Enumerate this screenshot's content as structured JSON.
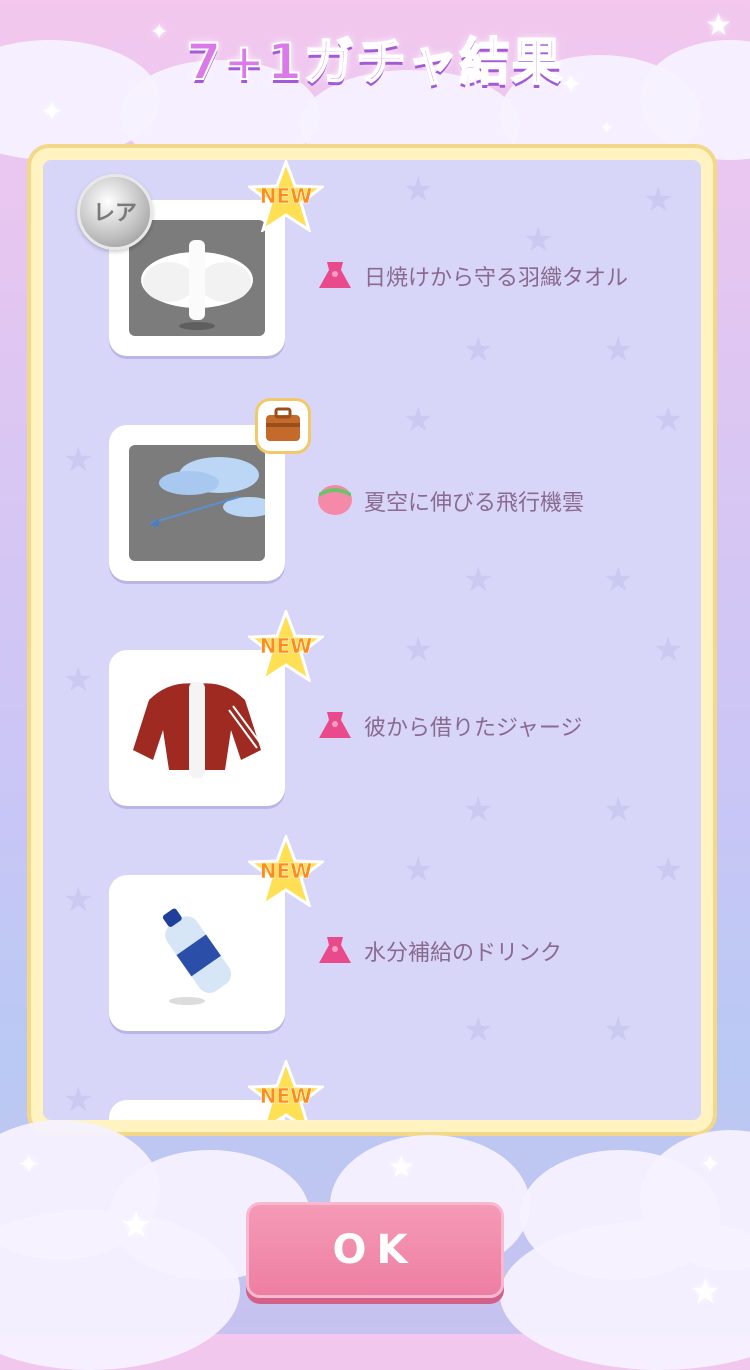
{
  "header": {
    "title": "7+1ガチャ結果"
  },
  "items": [
    {
      "name": "日焼けから守る羽織タオル",
      "badge": "NEW",
      "rare_label": "レア",
      "category_icon": "dress-icon",
      "thumb_bg": "gray",
      "thumb_icon": "towel-icon"
    },
    {
      "name": "夏空に伸びる飛行機雲",
      "badge": "",
      "category_icon": "background-icon",
      "thumb_bg": "gray",
      "thumb_icon": "contrail-icon",
      "extra_icon": "bag-icon"
    },
    {
      "name": "彼から借りたジャージ",
      "badge": "NEW",
      "category_icon": "dress-icon",
      "thumb_bg": "white",
      "thumb_icon": "jersey-icon"
    },
    {
      "name": "水分補給のドリンク",
      "badge": "NEW",
      "category_icon": "dress-icon",
      "thumb_bg": "white",
      "thumb_icon": "bottle-icon"
    },
    {
      "name": "",
      "badge": "NEW",
      "category_icon": "",
      "thumb_bg": "gray",
      "thumb_icon": ""
    }
  ],
  "footer": {
    "ok_label": "OK"
  },
  "colors": {
    "accent_pink": "#ee7ea3",
    "title_purple": "#d97ae8",
    "panel_border": "#f3d889",
    "panel_bg": "#d7d6f8",
    "new_orange": "#ff8c1a"
  }
}
